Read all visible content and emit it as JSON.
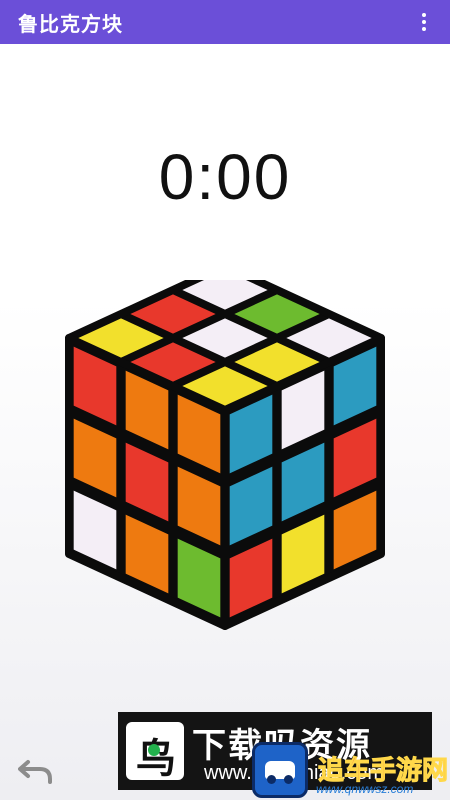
{
  "app": {
    "title": "鲁比克方块"
  },
  "timer": {
    "value": "0:00"
  },
  "icons": {
    "menu": "overflow-menu-icon",
    "undo": "undo-arrow-icon"
  },
  "colors": {
    "appbar": "#6b4fd8",
    "white": "#f4eef6",
    "red": "#e8382c",
    "orange": "#ee7a10",
    "yellow": "#f2e02c",
    "green": "#6dbb2f",
    "blue": "#2c9bc0"
  },
  "cube": {
    "top": [
      [
        "white",
        "red",
        "yellow"
      ],
      [
        "green",
        "white",
        "red"
      ],
      [
        "white",
        "yellow",
        "yellow"
      ]
    ],
    "left": [
      [
        "red",
        "orange",
        "orange"
      ],
      [
        "orange",
        "red",
        "orange"
      ],
      [
        "white",
        "orange",
        "green"
      ]
    ],
    "right": [
      [
        "blue",
        "white",
        "blue"
      ],
      [
        "blue",
        "blue",
        "red"
      ],
      [
        "red",
        "yellow",
        "orange"
      ]
    ]
  },
  "watermark": {
    "main_text": "下载吗资源",
    "url_text": "www.xiazainiao.com",
    "brand_text": "追车手游网",
    "brand_url": "www.qnwwsz.com"
  }
}
